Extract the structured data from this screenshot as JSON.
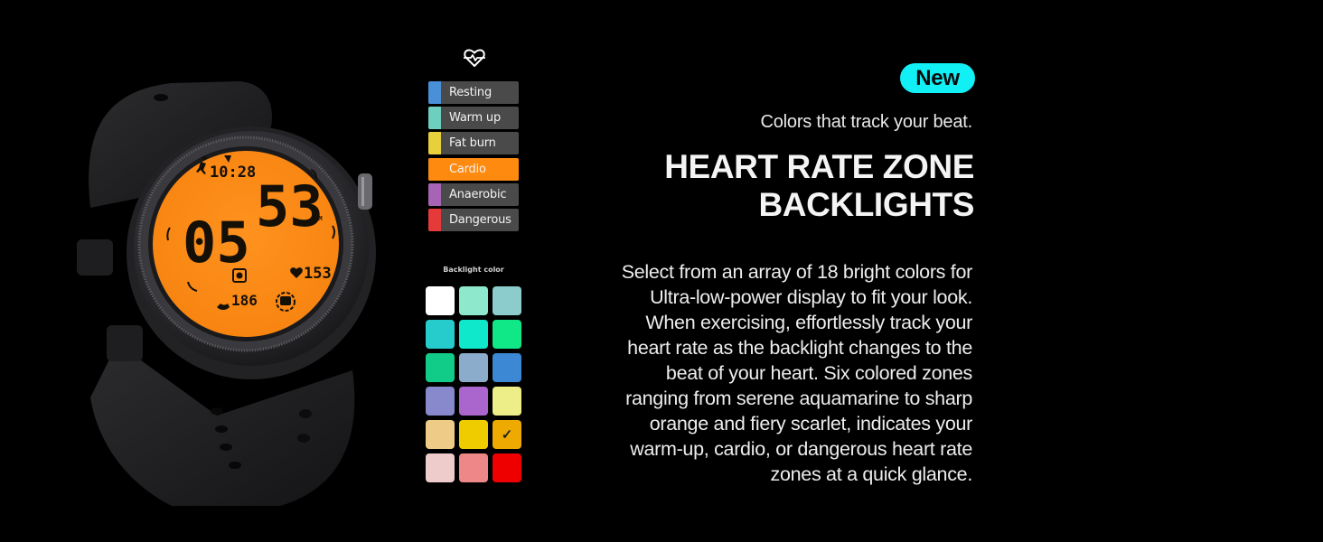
{
  "watch": {
    "time": "10:28",
    "pace_minutes": "05",
    "pace_seconds": "53",
    "pace_unit": "/KM",
    "heart_rate": "153",
    "steps": "186",
    "screen_color": "#ff8c1a"
  },
  "zones": {
    "icon": "heart-rate-icon",
    "items": [
      {
        "label": "Resting",
        "color": "#4a90d9",
        "active": false
      },
      {
        "label": "Warm up",
        "color": "#6ecfbf",
        "active": false
      },
      {
        "label": "Fat burn",
        "color": "#e8cf3c",
        "active": false
      },
      {
        "label": "Cardio",
        "color": "#ff8a10",
        "active": true
      },
      {
        "label": "Anaerobic",
        "color": "#a764b4",
        "active": false
      },
      {
        "label": "Dangerous",
        "color": "#e63a3a",
        "active": false
      }
    ]
  },
  "backlight": {
    "title": "Backlight color",
    "selected_index": 14,
    "check_glyph": "✓",
    "colors": [
      "#ffffff",
      "#8ee8cc",
      "#8ccccc",
      "#26cccc",
      "#10e8cc",
      "#10e888",
      "#10cc88",
      "#8caccc",
      "#3c88d4",
      "#8888cc",
      "#aa66cc",
      "#eeee88",
      "#eecc88",
      "#eecc00",
      "#eeaa00",
      "#eecccc",
      "#ee8888",
      "#ee0000"
    ]
  },
  "text": {
    "badge": "New",
    "tagline": "Colors that track your beat.",
    "headline_lines": [
      "HEART RATE ZONE",
      "BACKLIGHTS"
    ],
    "body_lines": [
      "Select from an array of 18 bright colors for",
      "Ultra-low-power display to fit your look.",
      "When exercising, effortlessly track your",
      "heart rate as the backlight changes to the",
      "beat of your heart. Six colored zones",
      "ranging from serene aquamarine to sharp",
      "orange and fiery scarlet, indicates your",
      "warm-up, cardio, or dangerous heart rate",
      "zones at a quick glance."
    ]
  }
}
